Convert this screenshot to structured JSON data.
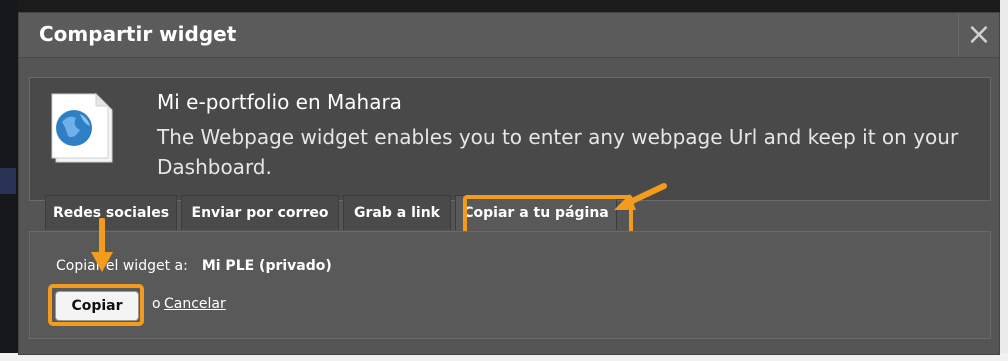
{
  "dialog": {
    "title": "Compartir widget",
    "close_label": "×"
  },
  "widget": {
    "name": "Mi e-portfolio en Mahara",
    "description": "The Webpage widget enables you to enter any webpage Url and keep it on your Dashboard.",
    "icon": "webpage-globe-icon"
  },
  "tabs": [
    {
      "label": "Redes sociales",
      "active": false
    },
    {
      "label": "Enviar por correo",
      "active": false
    },
    {
      "label": "Grab a link",
      "active": false
    },
    {
      "label": "Copiar a tu página",
      "active": true
    }
  ],
  "copy_panel": {
    "label": "Copiar el widget a:",
    "target_value": "Mi PLE (privado)",
    "copy_button": "Copiar",
    "or_text": "o",
    "cancel_link": "Cancelar"
  },
  "colors": {
    "highlight": "#f39b1c",
    "dialog_bg": "#555555"
  }
}
